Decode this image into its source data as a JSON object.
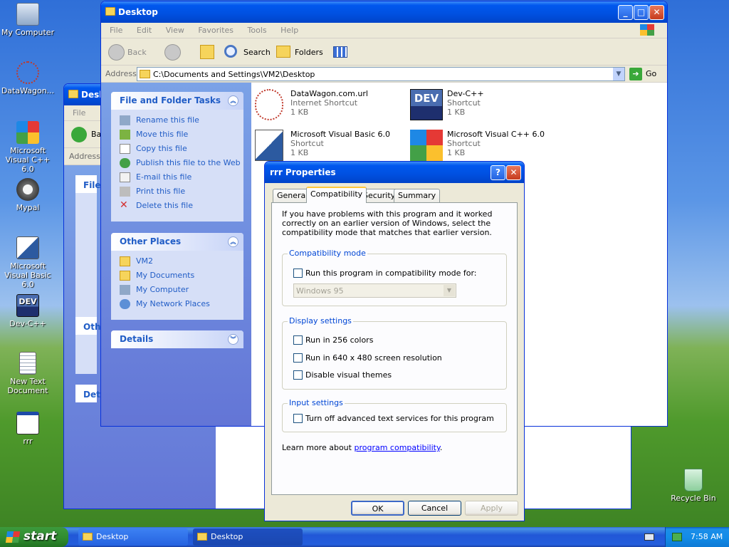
{
  "desktop": {
    "icons": [
      {
        "label": "My Computer"
      },
      {
        "label": "DataWagon..."
      },
      {
        "label": "Microsoft Visual C++ 6.0"
      },
      {
        "label": "Mypal"
      },
      {
        "label": "Microsoft Visual Basic 6.0"
      },
      {
        "label": "Dev-C++"
      },
      {
        "label": "New Text Document"
      },
      {
        "label": "rrr"
      },
      {
        "label": "Recycle Bin"
      }
    ]
  },
  "back_window": {
    "title": "Desktop",
    "menu": [
      "File"
    ],
    "back_label": "Ba",
    "address_label": "Address",
    "panel1": "File",
    "panel2": "Othe",
    "panel3": "Deta"
  },
  "explorer": {
    "title": "Desktop",
    "menu": [
      "File",
      "Edit",
      "View",
      "Favorites",
      "Tools",
      "Help"
    ],
    "toolbar": {
      "back": "Back",
      "search": "Search",
      "folders": "Folders"
    },
    "address": {
      "label": "Address",
      "value": "C:\\Documents and Settings\\VM2\\Desktop",
      "go": "Go"
    },
    "file_tasks": {
      "title": "File and Folder Tasks",
      "items": [
        "Rename this file",
        "Move this file",
        "Copy this file",
        "Publish this file to the Web",
        "E-mail this file",
        "Print this file",
        "Delete this file"
      ]
    },
    "other_places": {
      "title": "Other Places",
      "items": [
        "VM2",
        "My Documents",
        "My Computer",
        "My Network Places"
      ]
    },
    "details": {
      "title": "Details"
    },
    "files": [
      {
        "name": "DataWagon.com.url",
        "type": "Internet Shortcut",
        "size": "1 KB"
      },
      {
        "name": "Dev-C++",
        "type": "Shortcut",
        "size": "1 KB"
      },
      {
        "name": "Microsoft Visual Basic 6.0",
        "type": "Shortcut",
        "size": "1 KB"
      },
      {
        "name": "Microsoft Visual C++ 6.0",
        "type": "Shortcut",
        "size": "1 KB"
      }
    ]
  },
  "dialog": {
    "title": "rrr Properties",
    "tabs": [
      "General",
      "Compatibility",
      "Security",
      "Summary"
    ],
    "active_tab": "Compatibility",
    "intro": "If you have problems with this program and it worked correctly on an earlier version of Windows, select the compatibility mode that matches that earlier version.",
    "compat_group": "Compatibility mode",
    "compat_check": "Run this program in compatibility mode for:",
    "compat_select": "Windows 95",
    "display_group": "Display settings",
    "display_checks": [
      "Run in 256 colors",
      "Run in 640 x 480 screen resolution",
      "Disable visual themes"
    ],
    "input_group": "Input settings",
    "input_check": "Turn off advanced text services for this program",
    "learn_prefix": "Learn more about ",
    "learn_link": "program compatibility",
    "learn_suffix": ".",
    "buttons": {
      "ok": "OK",
      "cancel": "Cancel",
      "apply": "Apply"
    }
  },
  "taskbar": {
    "start": "start",
    "items": [
      "Desktop",
      "Desktop"
    ],
    "time": "7:58 AM"
  },
  "colors": {
    "title_blue": "#0058ee",
    "task_pane": "#6375d6",
    "link_blue": "#215dc6",
    "group_label": "#0046d5"
  }
}
